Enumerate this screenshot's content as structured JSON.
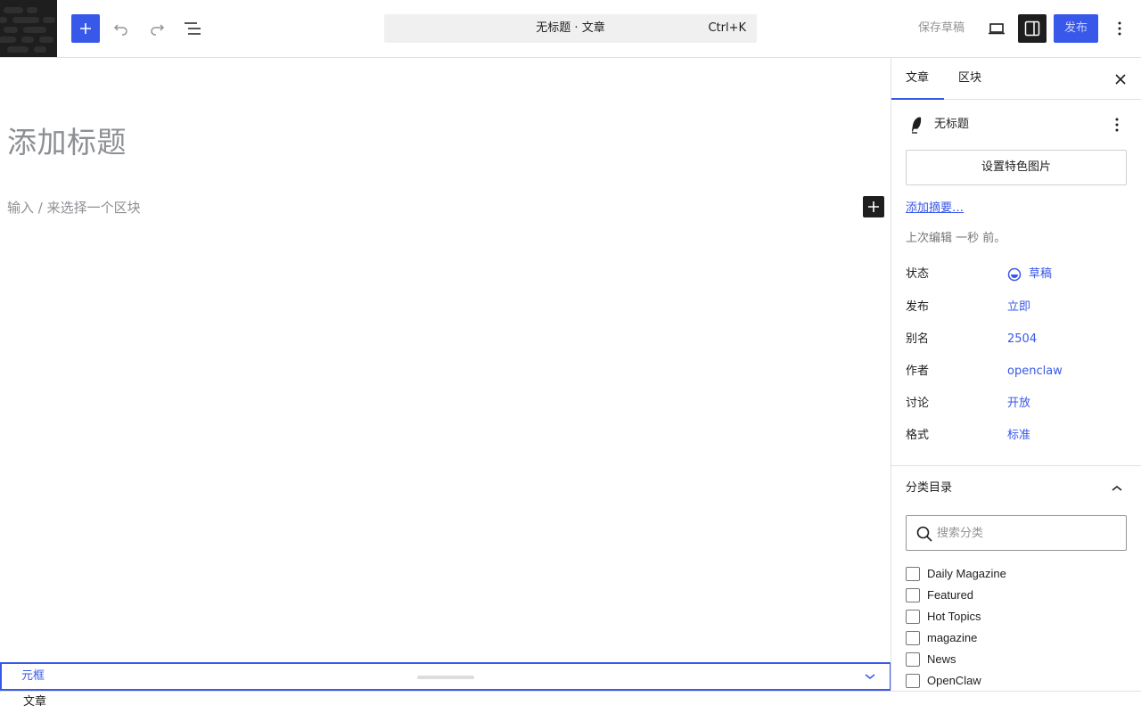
{
  "topbar": {
    "logo_icon": "site-logo-icon",
    "add_block_icon": "plus-icon",
    "undo_icon": "undo-icon",
    "redo_icon": "redo-icon",
    "outline_icon": "list-view-icon",
    "command_title": "无标题 · 文章",
    "command_shortcut": "Ctrl+K",
    "save_draft": "保存草稿",
    "view_icon": "laptop-icon",
    "settings_icon": "sidebar-toggle-icon",
    "publish": "发布",
    "more_icon": "vertical-dots-icon"
  },
  "editor": {
    "title_placeholder": "添加标题",
    "block_placeholder": "输入 / 来选择一个区块",
    "inserter_icon": "plus-icon"
  },
  "metabox": {
    "label": "元框",
    "chevron_icon": "chevron-down-icon"
  },
  "footer": {
    "breadcrumb": "文章"
  },
  "sidebar": {
    "tabs": [
      {
        "label": "文章",
        "active": true
      },
      {
        "label": "区块",
        "active": false
      }
    ],
    "close_icon": "close-icon",
    "post_icon": "feather-icon",
    "post_name": "无标题",
    "featured_image_button": "设置特色图片",
    "excerpt_link": "添加摘要…",
    "last_edited": "上次编辑 一秒 前。",
    "meta": [
      {
        "label": "状态",
        "value": "草稿"
      },
      {
        "label": "发布",
        "value": "立即"
      },
      {
        "label": "别名",
        "value": "2504"
      },
      {
        "label": "作者",
        "value": "openclaw"
      },
      {
        "label": "讨论",
        "value": "开放"
      },
      {
        "label": "格式",
        "value": "标准"
      }
    ],
    "categories": {
      "title": "分类目录",
      "search_placeholder": "搜索分类",
      "items": [
        "Daily Magazine",
        "Featured",
        "Hot Topics",
        "magazine",
        "News",
        "OpenClaw"
      ]
    }
  },
  "colors": {
    "accent": "#3858e9",
    "dark": "#1e1e1e",
    "muted": "#8c8f94"
  }
}
